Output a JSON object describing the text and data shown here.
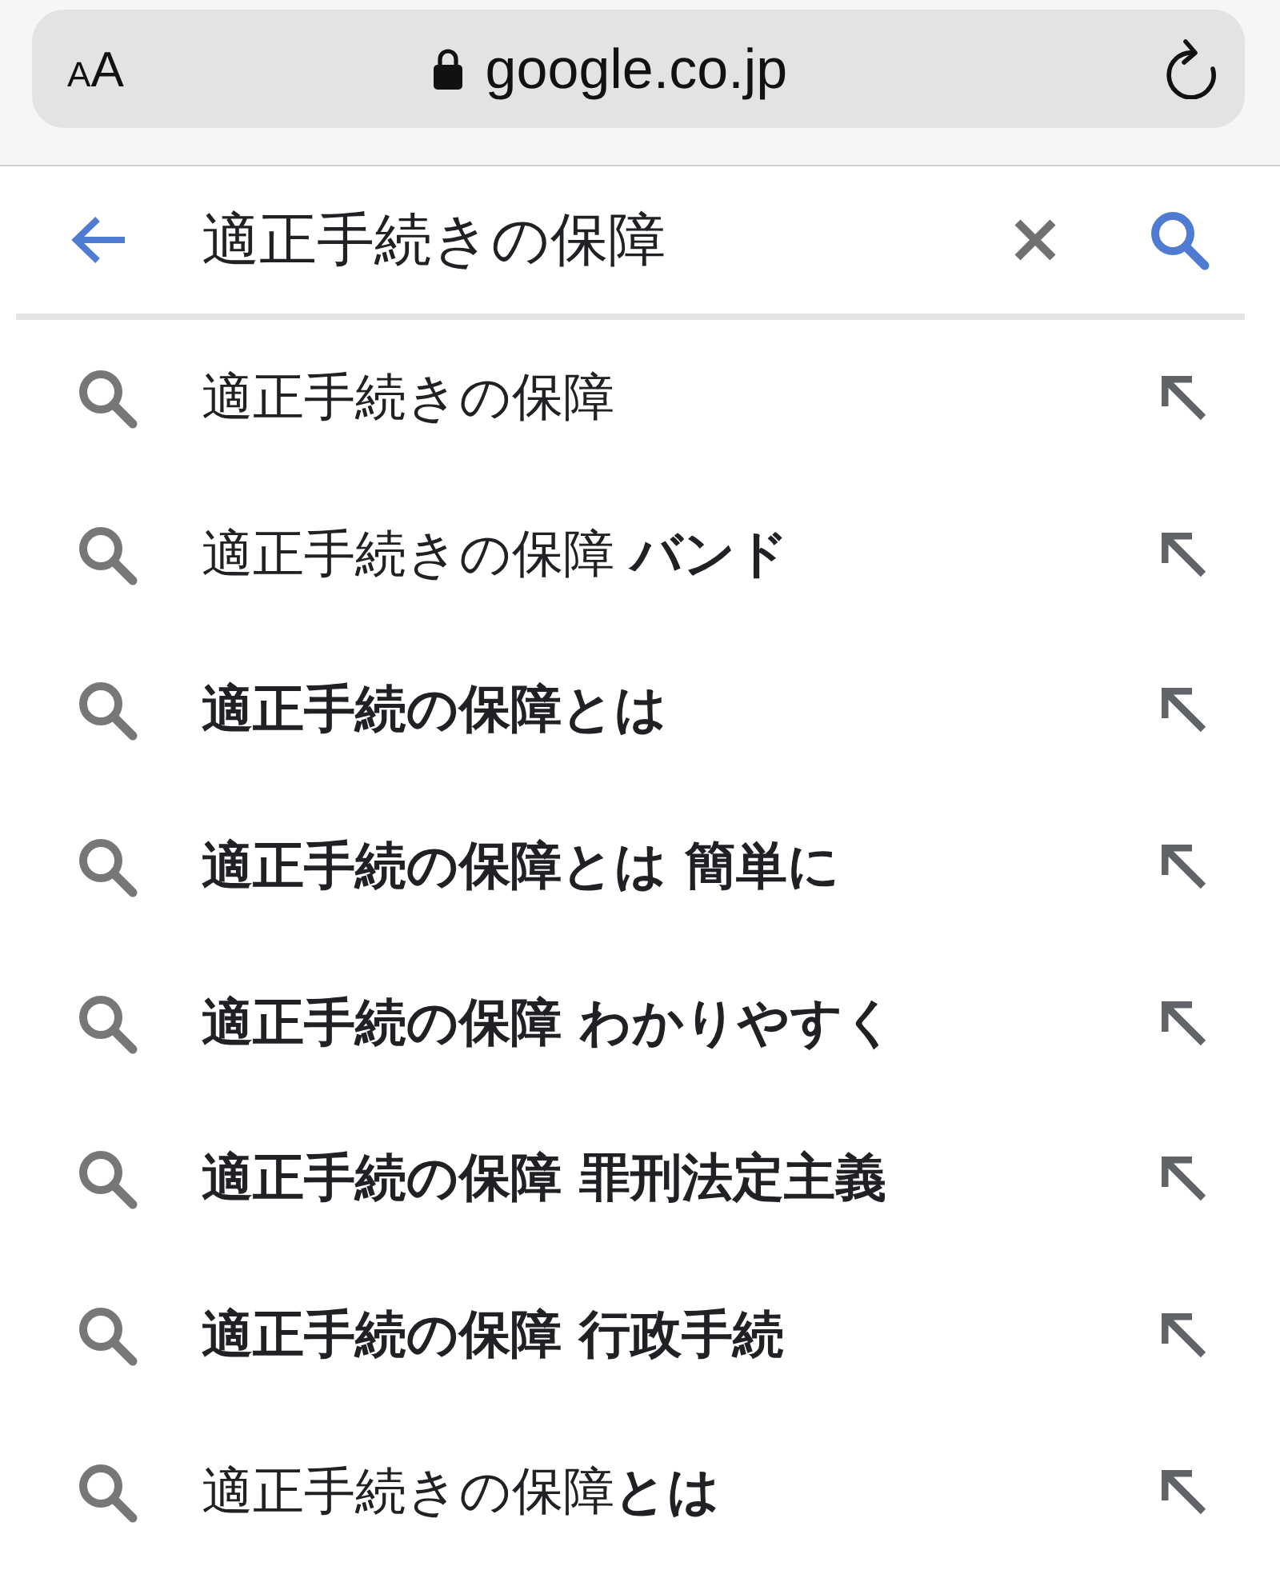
{
  "address_bar": {
    "text_size_button": "AA",
    "url": "google.co.jp"
  },
  "search_bar": {
    "value": "適正手続きの保障"
  },
  "suggestions": [
    {
      "text": "適正手続きの保障",
      "bold": false
    },
    {
      "text": "適正手続きの保障 **バンド**",
      "bold": false
    },
    {
      "text": "適正手続の保障とは",
      "bold": true
    },
    {
      "text": "適正手続の保障とは 簡単に",
      "bold": true
    },
    {
      "text": "適正手続の保障 わかりやすく",
      "bold": true
    },
    {
      "text": "適正手続の保障 罪刑法定主義",
      "bold": true
    },
    {
      "text": "適正手続の保障 行政手続",
      "bold": true
    },
    {
      "text": "適正手続きの保障**とは**",
      "bold": false
    }
  ]
}
